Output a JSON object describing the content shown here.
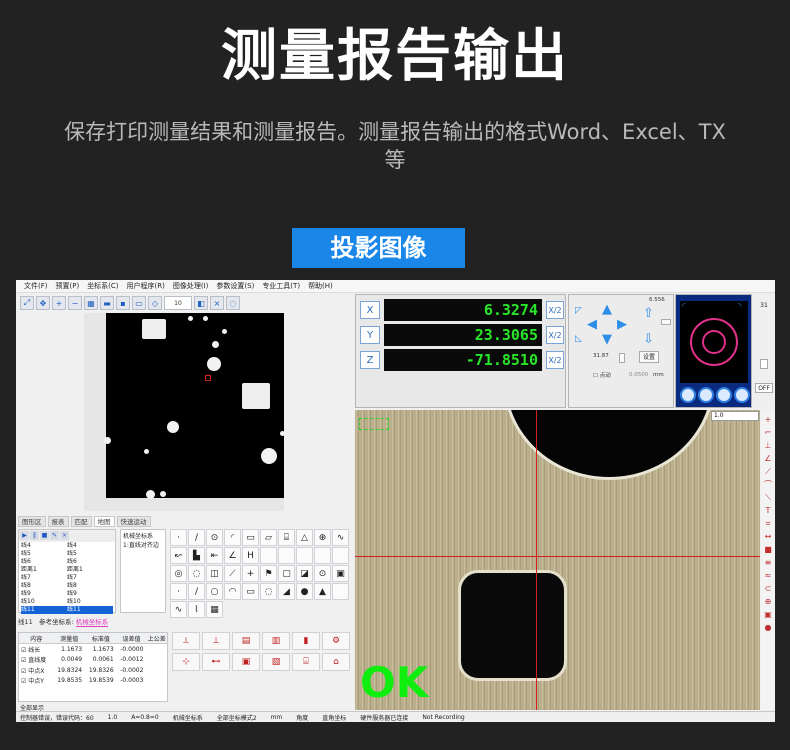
{
  "headline": "测量报告输出",
  "subtitle": "保存打印测量结果和测量报告。测量报告输出的格式Word、Excel、TX等",
  "section_badge": "投影图像",
  "app": {
    "menu": [
      "文件(F)",
      "预置(P)",
      "坐标系(C)",
      "用户程序(R)",
      "图像处理(I)",
      "参数设置(S)",
      "专业工具(T)",
      "帮助(H)"
    ],
    "toolbar_zoom": "10",
    "tabs": [
      "图形区",
      "报表",
      "匹配",
      "地图",
      "快速运动"
    ],
    "active_tab": "地图",
    "elements": [
      "线4",
      "线4",
      "线5",
      "线5",
      "线6",
      "线6",
      "距离1",
      "距离1",
      "线7",
      "线7",
      "线8",
      "线8",
      "线9",
      "线9",
      "线10",
      "线10",
      "线11",
      "线11"
    ],
    "selected_element": "线11",
    "coord_system_label": "机械坐标系",
    "coord_item": "1:直线对齐边",
    "element_name": "线11",
    "reference_label": "参考坐标系:",
    "reference_value": "机械坐标系",
    "results_header": [
      "内容",
      "测量值",
      "标准值",
      "误差值",
      "上公差"
    ],
    "results": [
      {
        "name": "线长",
        "measured": "1.1673",
        "standard": "1.1673",
        "error": "-0.0000"
      },
      {
        "name": "直线度",
        "measured": "0.0049",
        "standard": "0.0061",
        "error": "-0.0012"
      },
      {
        "name": "中点X",
        "measured": "19.8324",
        "standard": "19.8326",
        "error": "-0.0002"
      },
      {
        "name": "中点Y",
        "measured": "19.8535",
        "standard": "19.8539",
        "error": "-0.0003"
      }
    ],
    "show_all_label": "全部显示",
    "dro": {
      "x_label": "X",
      "x_value": "6.3274",
      "y_label": "Y",
      "y_value": "23.3065",
      "z_label": "Z",
      "z_value": "-71.8510",
      "unit_btn": "X/2"
    },
    "jog": {
      "speed_top": "6.556",
      "speed_bottom": "31.87",
      "setting_btn": "设置",
      "inching_label": "点动",
      "step_value": "0.0500",
      "step_unit": "mm"
    },
    "light": {
      "value_top": "31",
      "off_btn": "OFF"
    },
    "camera": {
      "result_text": "OK",
      "zoom_value": "1.0"
    },
    "status": [
      "控制器错误，错误代码：60",
      "1.0",
      "A=0.8=0",
      "机械坐标系",
      "全部坐标模式2",
      "mm",
      "角度",
      "直角坐标",
      "硬件服务器已连接",
      "Not Recording"
    ]
  }
}
